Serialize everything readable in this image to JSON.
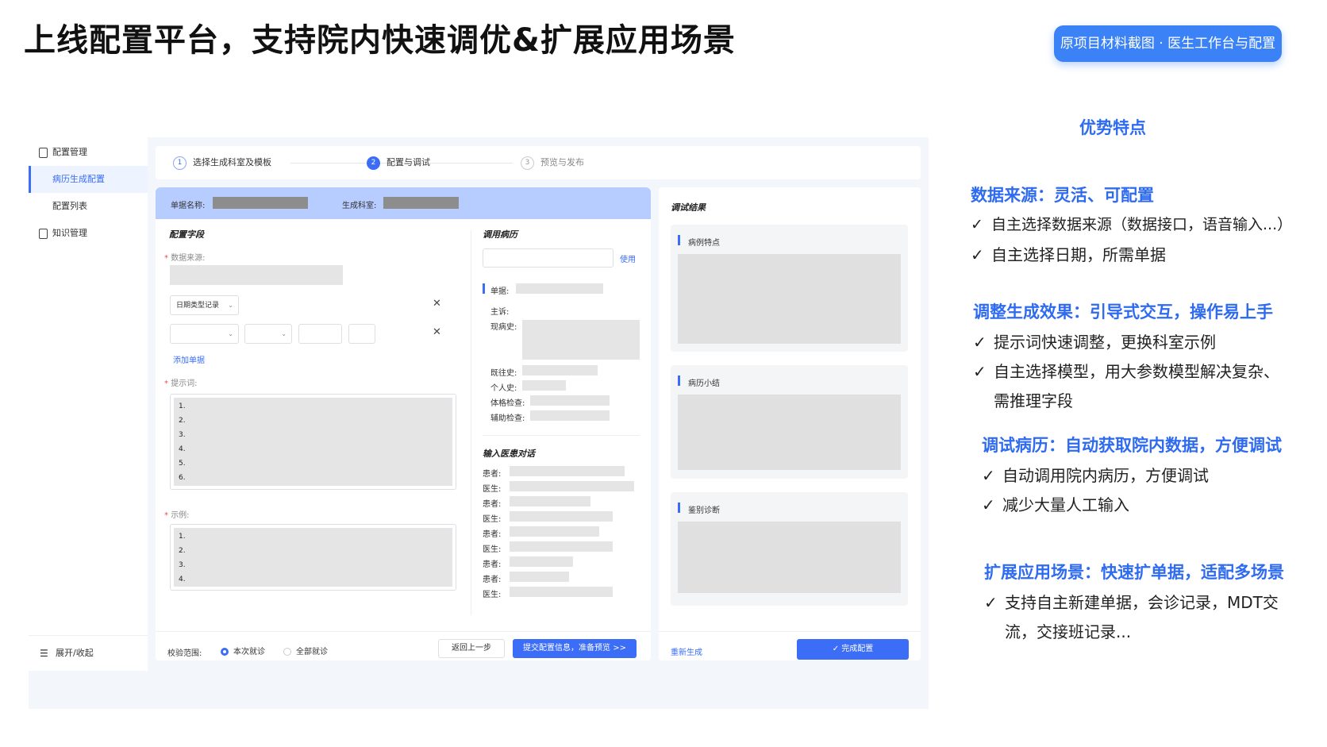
{
  "slide": {
    "title": "上线配置平台，支持院内快速调优&扩展应用场景",
    "source_badge": "原项目材料截图 · 医生工作台与配置"
  },
  "sidebar": {
    "items": [
      {
        "label": "配置管理",
        "icon": "document-icon"
      },
      {
        "label": "病历生成配置",
        "active": true
      },
      {
        "label": "配置列表"
      },
      {
        "label": "知识管理",
        "icon": "document-icon"
      }
    ],
    "footer": "展开/收起",
    "footer_icon": "menu-icon"
  },
  "steps": [
    {
      "num": "1",
      "label": "选择生成科室及模板"
    },
    {
      "num": "2",
      "label": "配置与调试"
    },
    {
      "num": "3",
      "label": "预览与发布"
    }
  ],
  "form_header": {
    "doc_name_label": "单据名称:",
    "dept_label": "生成科室:"
  },
  "config": {
    "title": "配置字段",
    "data_source_label": "数据来源:",
    "date_type_select": "日期类型记录",
    "add_doc_link": "添加单据",
    "prompt_label": "提示词:",
    "prompt_lines": [
      "1.",
      "2.",
      "3.",
      "4.",
      "5.",
      "6."
    ],
    "example_label": "示例:",
    "example_lines": [
      "1.",
      "2.",
      "3.",
      "4."
    ]
  },
  "call_record": {
    "title": "调用病历",
    "use_link": "使用",
    "doc_label": "单据:",
    "fields": [
      "主诉:",
      "现病史:",
      "既往史:",
      "个人史:",
      "体格检查:",
      "辅助检查:"
    ],
    "dialog_title": "输入医患对话",
    "dialog_roles": [
      "患者:",
      "医生:",
      "患者:",
      "医生:",
      "患者:",
      "医生:",
      "患者:",
      "患者:",
      "医生:"
    ]
  },
  "debug": {
    "title": "调试结果",
    "blocks": [
      "病例特点",
      "病历小结",
      "鉴别诊断"
    ],
    "regen_link": "重新生成",
    "finish_button": "完成配置"
  },
  "footer_bar": {
    "scope_label": "校验范围:",
    "options": [
      "本次就诊",
      "全部就诊"
    ],
    "selected_index": 0,
    "back_button": "返回上一步",
    "submit_button": "提交配置信息，准备预览 >>"
  },
  "advantages": {
    "title": "优势特点",
    "sections": [
      {
        "heading": "数据来源：灵活、可配置",
        "points": [
          "自主选择数据来源（数据接口，语音输入...）",
          "自主选择日期，所需单据"
        ]
      },
      {
        "heading": "调整生成效果：引导式交互，操作易上手",
        "points": [
          "提示词快速调整，更换科室示例",
          "自主选择模型，用大参数模型解决复杂、",
          "需推理字段"
        ]
      },
      {
        "heading": "调试病历：自动获取院内数据，方便调试",
        "points": [
          "自动调用院内病历，方便调试",
          "减少大量人工输入"
        ]
      },
      {
        "heading": "扩展应用场景：快速扩单据，适配多场景",
        "points": [
          "支持自主新建单据，会诊记录，MDT交",
          "流，交接班记录..."
        ]
      }
    ],
    "check_glyph": "✓"
  },
  "colors": {
    "accent": "#3b6df6",
    "heading_blue": "#2f6bef",
    "header_band": "#b7ccff",
    "placeholder_gray": "#e5e5e5"
  }
}
